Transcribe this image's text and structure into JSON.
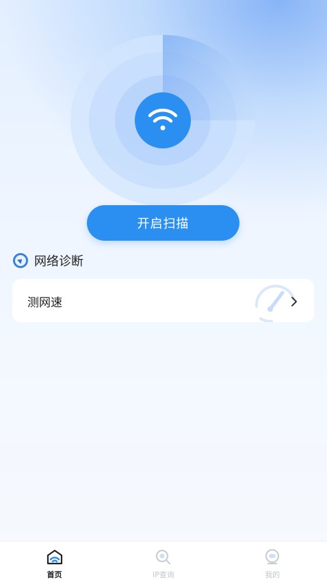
{
  "home": {
    "scan_button": "开启扫描",
    "section_title": "网络诊断",
    "cards": [
      {
        "label": "测网速"
      }
    ]
  },
  "tabbar": {
    "tabs": [
      {
        "label": "首页",
        "active": true
      },
      {
        "label": "IP查询",
        "active": false
      },
      {
        "label": "我的",
        "active": false
      }
    ]
  },
  "colors": {
    "accent": "#2b8ff2",
    "text": "#222222",
    "tab_inactive": "#c2c6cf"
  },
  "icons": {
    "radar": "wifi-icon",
    "section": "compass-icon",
    "card": "speedometer-icon",
    "card_arrow": "chevron-right-icon",
    "tabs": [
      "home-wifi-icon",
      "ip-search-icon",
      "profile-eye-icon"
    ]
  }
}
